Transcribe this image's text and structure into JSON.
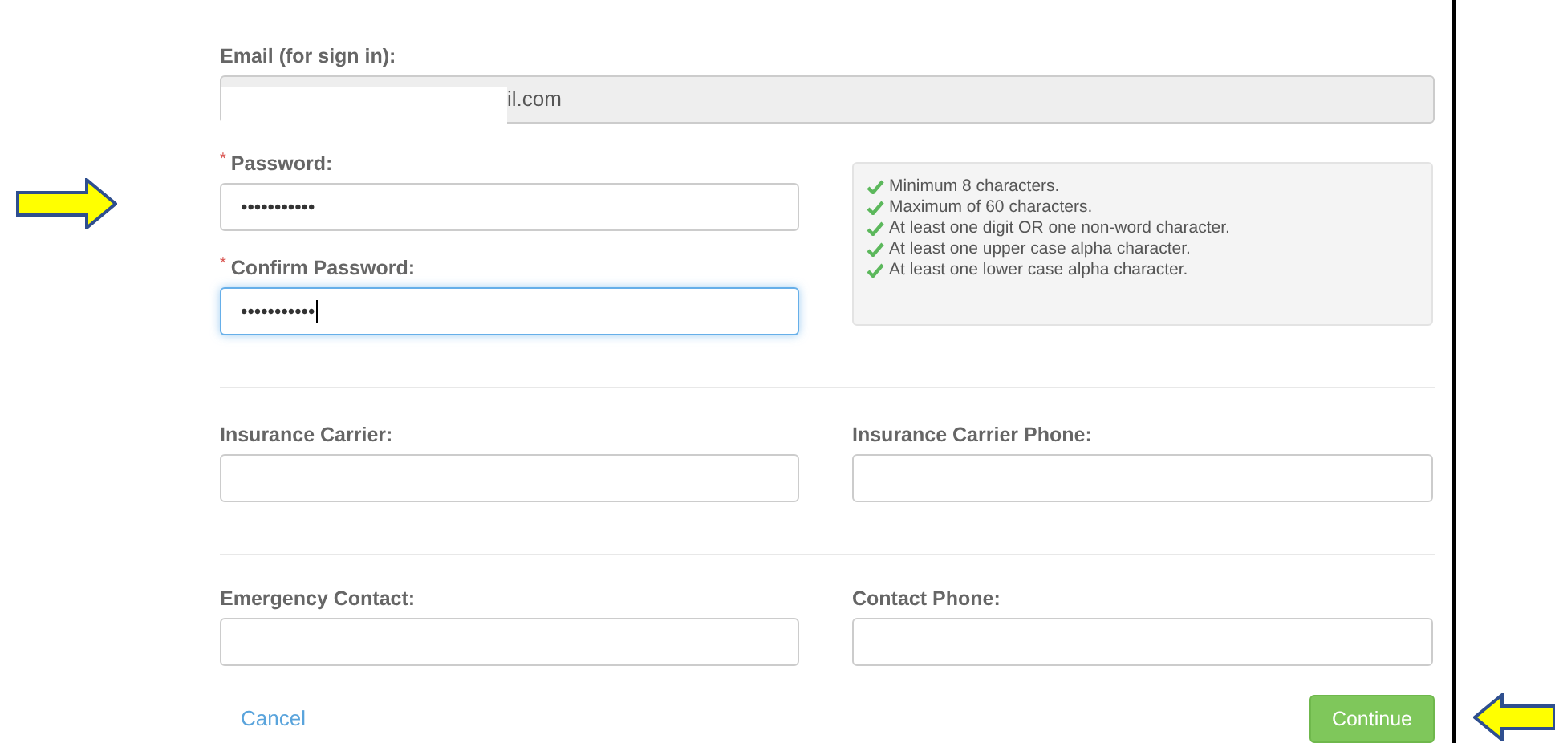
{
  "email": {
    "label": "Email (for sign in):",
    "value": "il.com",
    "redacted": true
  },
  "password": {
    "label": "Password:",
    "required_mark": "*",
    "value": "•••••••••••",
    "focused": false
  },
  "confirm_password": {
    "label": "Confirm Password:",
    "required_mark": "*",
    "value": "•••••••••••",
    "focused": true
  },
  "requirements": [
    {
      "text": "Minimum 8 characters.",
      "met": true
    },
    {
      "text": "Maximum of 60 characters.",
      "met": true
    },
    {
      "text": "At least one digit OR one non-word character.",
      "met": true
    },
    {
      "text": "At least one upper case alpha character.",
      "met": true
    },
    {
      "text": "At least one lower case alpha character.",
      "met": true
    }
  ],
  "fields": [
    {
      "label": "Insurance Carrier:"
    },
    {
      "label": "Insurance Carrier Phone:"
    },
    {
      "label": "Emergency Contact:"
    },
    {
      "label": "Contact Phone:"
    }
  ],
  "cancel": "Cancel",
  "continue": "Continue"
}
